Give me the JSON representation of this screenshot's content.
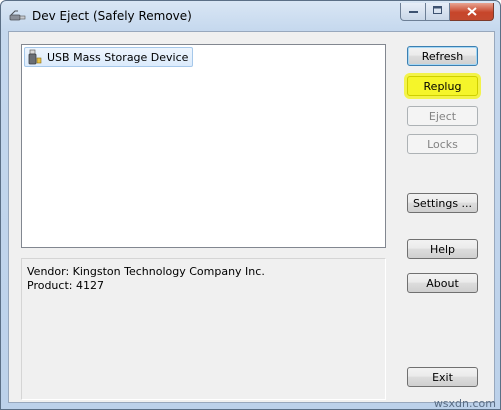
{
  "window": {
    "title": "Dev Eject (Safely Remove)",
    "icons": {
      "app": "usb-plug-icon",
      "minimize": "minimize-icon",
      "maximize": "maximize-icon",
      "close": "close-icon"
    }
  },
  "devices": [
    {
      "label": "USB Mass Storage Device",
      "icon": "usb-drive-icon"
    }
  ],
  "info": {
    "vendor": "Vendor: Kingston Technology Company Inc.",
    "product": "Product: 4127"
  },
  "buttons": {
    "refresh": "Refresh",
    "replug": "Replug",
    "eject": "Eject",
    "locks": "Locks",
    "settings": "Settings ...",
    "help": "Help",
    "about": "About",
    "exit": "Exit"
  },
  "colors": {
    "highlight": "#f5f52a",
    "close_button": "#c7452a"
  },
  "watermark": "wsxdn.com"
}
